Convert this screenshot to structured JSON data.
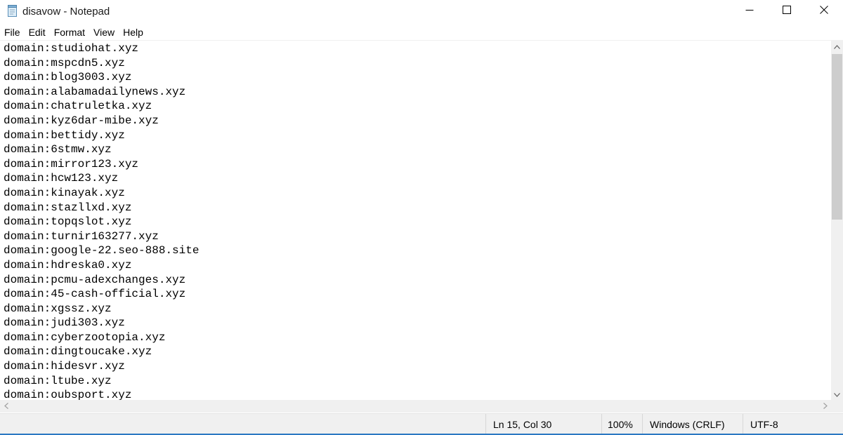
{
  "window": {
    "title": "disavow - Notepad",
    "icon": "notepad-icon",
    "controls": {
      "minimize_icon": "minimize-icon",
      "maximize_icon": "maximize-icon",
      "close_icon": "close-icon"
    }
  },
  "menu": {
    "items": [
      "File",
      "Edit",
      "Format",
      "View",
      "Help"
    ]
  },
  "editor": {
    "lines": [
      "domain:studiohat.xyz",
      "domain:mspcdn5.xyz",
      "domain:blog3003.xyz",
      "domain:alabamadailynews.xyz",
      "domain:chatruletka.xyz",
      "domain:kyz6dar-mibe.xyz",
      "domain:bettidy.xyz",
      "domain:6stmw.xyz",
      "domain:mirror123.xyz",
      "domain:hcw123.xyz",
      "domain:kinayak.xyz",
      "domain:stazllxd.xyz",
      "domain:topqslot.xyz",
      "domain:turnir163277.xyz",
      "domain:google-22.seo-888.site",
      "domain:hdreska0.xyz",
      "domain:pcmu-adexchanges.xyz",
      "domain:45-cash-official.xyz",
      "domain:xgssz.xyz",
      "domain:judi303.xyz",
      "domain:cyberzootopia.xyz",
      "domain:dingtoucake.xyz",
      "domain:hidesvr.xyz",
      "domain:ltube.xyz",
      "domain:oubsport.xyz"
    ]
  },
  "statusbar": {
    "position": "Ln 15, Col 30",
    "zoom": "100%",
    "line_endings": "Windows (CRLF)",
    "encoding": "UTF-8"
  },
  "colors": {
    "accent": "#2b78c2",
    "chrome": "#f0f0f0",
    "scroll_thumb": "#cdcdcd"
  }
}
